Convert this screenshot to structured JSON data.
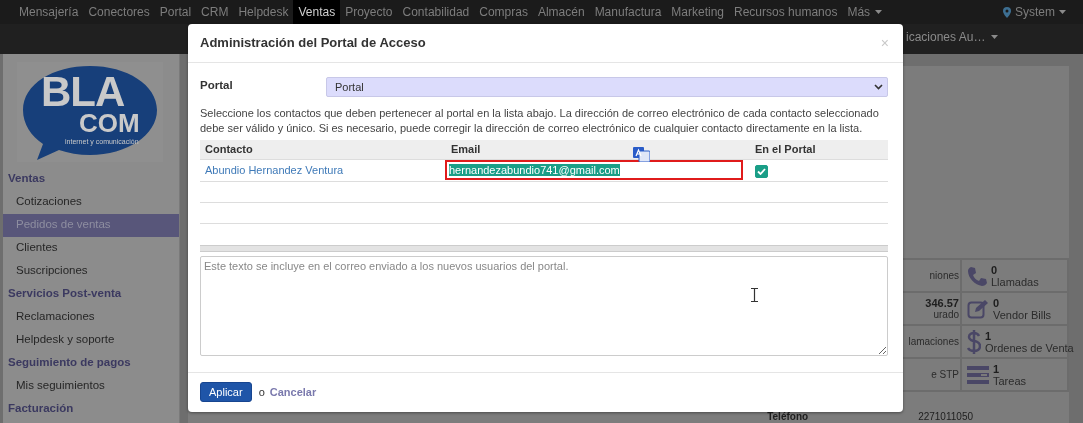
{
  "navbar": {
    "items": [
      {
        "label": "Mensajería",
        "selected": false
      },
      {
        "label": "Conectores",
        "selected": false
      },
      {
        "label": "Portal",
        "selected": false
      },
      {
        "label": "CRM",
        "selected": false
      },
      {
        "label": "Helpdesk",
        "selected": false
      },
      {
        "label": "Ventas",
        "selected": true
      },
      {
        "label": "Proyecto",
        "selected": false
      },
      {
        "label": "Contabilidad",
        "selected": false
      },
      {
        "label": "Compras",
        "selected": false
      },
      {
        "label": "Almacén",
        "selected": false
      },
      {
        "label": "Manufactura",
        "selected": false
      },
      {
        "label": "Marketing",
        "selected": false
      },
      {
        "label": "Recursos humanos",
        "selected": false
      }
    ],
    "more": "Más",
    "user": "System"
  },
  "subbar": {
    "menu": "icaciones Au…"
  },
  "logo": {
    "top": "BLA",
    "bottom": "COM",
    "tagline": "internet y comunicación"
  },
  "sidebar": {
    "sections": [
      {
        "title": "Ventas",
        "items": [
          {
            "label": "Cotizaciones",
            "selected": false
          },
          {
            "label": "Pedidos de ventas",
            "selected": true
          },
          {
            "label": "Clientes",
            "selected": false
          },
          {
            "label": "Suscripciones",
            "selected": false
          }
        ]
      },
      {
        "title": "Servicios Post-venta",
        "items": [
          {
            "label": "Reclamaciones",
            "selected": false
          },
          {
            "label": "Helpdesk y soporte",
            "selected": false
          }
        ]
      },
      {
        "title": "Seguimiento de pagos",
        "items": [
          {
            "label": "Mis seguimientos",
            "selected": false
          }
        ]
      },
      {
        "title": "Facturación"
      }
    ]
  },
  "stats": [
    {
      "partial": "niones",
      "value": "0",
      "label": "Llamadas"
    },
    {
      "partial_value": "346.57",
      "partial": "urado",
      "value": "0",
      "label": "Vendor Bills"
    },
    {
      "partial": "lamaciones",
      "value": "1",
      "label": "Ordenes de Venta"
    },
    {
      "partial": "e STP",
      "value": "1",
      "label": "Tareas"
    }
  ],
  "form": {
    "phone_label": "Teléfono",
    "phone_value": "2271011050"
  },
  "dialog": {
    "title": "Administración del Portal de Acceso",
    "close": "×",
    "portal_label": "Portal",
    "portal_value": "Portal",
    "help": "Seleccione los contactos que deben pertenecer al portal en la lista abajo. La dirección de correo electrónico de cada contacto seleccionado debe ser válido y único. Si es necesario, puede corregir la dirección de correo electrónico de cualquier contacto directamente en la lista.",
    "columns": [
      "Contacto",
      "Email",
      "En el Portal"
    ],
    "rows": [
      {
        "contact": "Abundio Hernandez Ventura",
        "email": "hernandezabundio741@gmail.com",
        "email_selected": true,
        "in_portal": true
      }
    ],
    "message_placeholder": "Este texto se incluye en el correo enviado a los nuevos usuarios del portal.",
    "apply": "Aplicar",
    "or": "o",
    "cancel": "Cancelar"
  }
}
